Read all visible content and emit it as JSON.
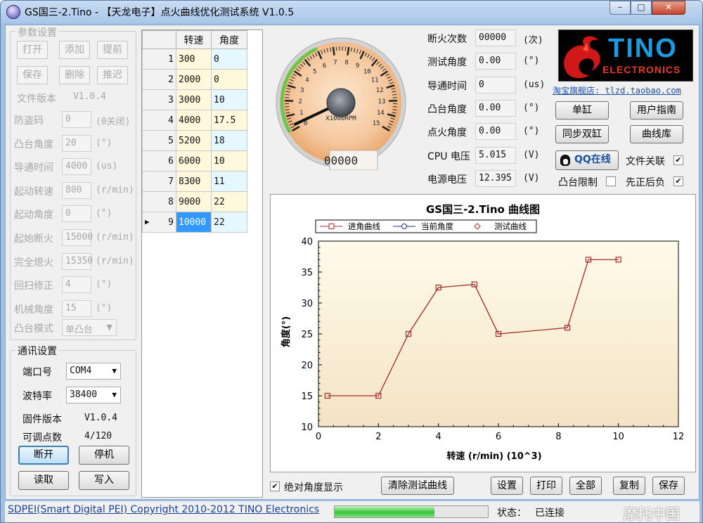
{
  "window": {
    "title": "GS国三-2.Tino - 【天龙电子】点火曲线优化测试系统 V1.0.5",
    "min": "–",
    "max": "□",
    "close": "✕"
  },
  "params": {
    "group_title": "参数设置",
    "buttons": {
      "open": "打开",
      "add": "添加",
      "prev": "提前",
      "save": "保存",
      "delete": "删除",
      "retard": "推迟"
    },
    "file_version_label": "文件版本",
    "file_version": "V1.0.4",
    "rows": [
      {
        "label": "防盗码",
        "value": "0",
        "unit": "(0关闭)"
      },
      {
        "label": "凸台角度",
        "value": "20",
        "unit": "(°)"
      },
      {
        "label": "导通时间",
        "value": "4000",
        "unit": "(us)"
      },
      {
        "label": "起动转速",
        "value": "800",
        "unit": "(r/min)"
      },
      {
        "label": "起动角度",
        "value": "0",
        "unit": "(°)"
      },
      {
        "label": "起始断火",
        "value": "15000",
        "unit": "(r/min)"
      },
      {
        "label": "完全熄火",
        "value": "15350",
        "unit": "(r/min)"
      },
      {
        "label": "回扫修正",
        "value": "4",
        "unit": "(°)"
      },
      {
        "label": "机械角度",
        "value": "15",
        "unit": "(°)"
      }
    ],
    "mode_label": "凸台模式",
    "mode_value": "单凸台"
  },
  "comm": {
    "group_title": "通讯设置",
    "port_label": "端口号",
    "port_value": "COM4",
    "baud_label": "波特率",
    "baud_value": "38400",
    "fw_label": "固件版本",
    "fw_value": "V1.0.4",
    "points_label": "可调点数",
    "points_value": "4/120",
    "buttons": {
      "disconnect": "断开",
      "stop": "停机",
      "read": "读取",
      "write": "写入"
    }
  },
  "table": {
    "headers": [
      "转速",
      "角度"
    ],
    "rows": [
      {
        "n": "1",
        "rpm": "300",
        "deg": "0"
      },
      {
        "n": "2",
        "rpm": "2000",
        "deg": "0"
      },
      {
        "n": "3",
        "rpm": "3000",
        "deg": "10"
      },
      {
        "n": "4",
        "rpm": "4000",
        "deg": "17.5"
      },
      {
        "n": "5",
        "rpm": "5200",
        "deg": "18"
      },
      {
        "n": "6",
        "rpm": "6000",
        "deg": "10"
      },
      {
        "n": "7",
        "rpm": "8300",
        "deg": "11"
      },
      {
        "n": "8",
        "rpm": "9000",
        "deg": "22"
      },
      {
        "n": "9",
        "rpm": "10000",
        "deg": "22"
      }
    ],
    "current_marker": "▶"
  },
  "gauge": {
    "ticks": [
      "0",
      "1",
      "2",
      "3",
      "4",
      "5",
      "6",
      "7",
      "8",
      "9",
      "10",
      "11",
      "12",
      "13",
      "14",
      "15"
    ],
    "unit": "X1000RPM",
    "counter": "00000",
    "needle_value": 0.3
  },
  "readouts": [
    {
      "label": "断火次数",
      "value": "00000",
      "unit": "(次)"
    },
    {
      "label": "测试角度",
      "value": "0.00",
      "unit": "(°)"
    },
    {
      "label": "导通时间",
      "value": "0",
      "unit": "(us)"
    },
    {
      "label": "凸台角度",
      "value": "0.00",
      "unit": "(°)"
    },
    {
      "label": "点火角度",
      "value": "0.00",
      "unit": "(°)"
    },
    {
      "label": "CPU 电压",
      "value": "5.015",
      "unit": "(V)"
    },
    {
      "label": "电源电压",
      "value": "12.395",
      "unit": "(V)"
    }
  ],
  "logo": {
    "brand": "TINO",
    "sub": "ELECTRONICS",
    "shop": "淘宝旗舰店: tlzd.taobao.com"
  },
  "right_buttons": {
    "single": "单缸",
    "guide": "用户指南",
    "dual": "同步双缸",
    "library": "曲线库",
    "qq": "QQ在线"
  },
  "checks": {
    "file_assoc": {
      "label": "文件关联",
      "checked": true
    },
    "boss_limit": {
      "label": "凸台限制",
      "checked": false
    },
    "pos_neg": {
      "label": "先正后负",
      "checked": true
    },
    "abs_angle": {
      "label": "绝对角度显示",
      "checked": true
    }
  },
  "bottom_buttons": {
    "clear": "清除测试曲线",
    "settings": "设置",
    "print": "打印",
    "all": "全部",
    "copy": "复制",
    "save": "保存"
  },
  "chart_data": {
    "type": "line",
    "title": "GS国三-2.Tino 曲线图",
    "xlabel": "转速 (r/min) (10^3)",
    "ylabel": "角度(°)",
    "xlim": [
      0,
      12
    ],
    "ylim": [
      10,
      40
    ],
    "xticks": [
      0,
      2,
      4,
      6,
      8,
      10,
      12
    ],
    "yticks": [
      10,
      15,
      20,
      25,
      30,
      35,
      40
    ],
    "legend_position": "top",
    "series": [
      {
        "name": "进角曲线",
        "color": "#a52a2a",
        "marker": "square",
        "x": [
          0.3,
          2,
          3,
          4,
          5.2,
          6,
          8.3,
          9,
          10
        ],
        "y": [
          15,
          15,
          25,
          32.5,
          33,
          25,
          26,
          37,
          37
        ]
      },
      {
        "name": "当前角度",
        "color": "#1c2f8a",
        "marker": "circle",
        "x": [],
        "y": []
      },
      {
        "name": "测试曲线",
        "color": "#a52a2a",
        "marker": "diamond",
        "x": [],
        "y": []
      }
    ]
  },
  "statusbar": {
    "copyright": "SDPEI(Smart Digital PEI) Copyright 2010-2012 TINO Electronics",
    "progress": 0.65,
    "state_label": "状态：",
    "state_value": "已连接",
    "watermark": "摩托中国"
  }
}
